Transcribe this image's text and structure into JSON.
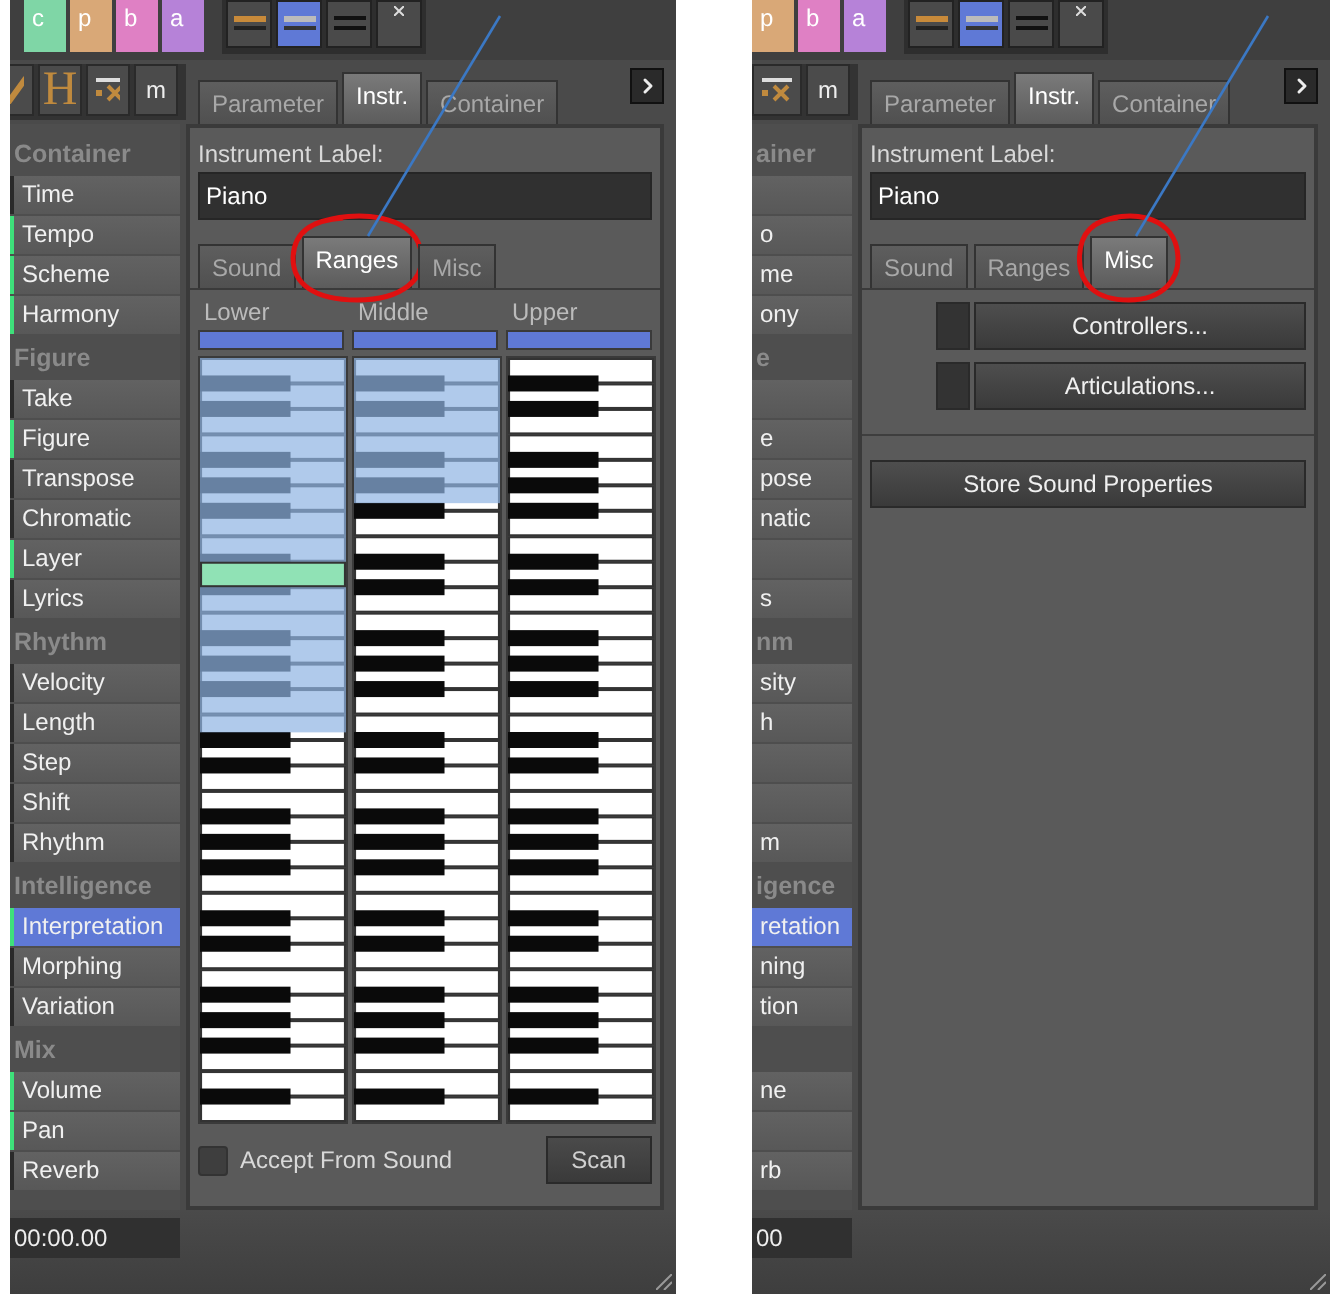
{
  "panels": [
    {
      "swatches": [
        {
          "label": "c",
          "color": "#7fd6a6"
        },
        {
          "label": "p",
          "color": "#d9a877"
        },
        {
          "label": "b",
          "color": "#df80c4"
        },
        {
          "label": "a",
          "color": "#b682d8"
        }
      ],
      "tool_buttons": [
        {
          "kind": "orange-bar",
          "selected": false
        },
        {
          "kind": "grey-bar",
          "selected": true
        },
        {
          "kind": "lines",
          "selected": false
        },
        {
          "kind": "close",
          "selected": false
        }
      ],
      "mode_buttons": [
        {
          "kind": "check"
        },
        {
          "kind": "serif-letter",
          "label": "H"
        },
        {
          "kind": "formula"
        },
        {
          "kind": "letter",
          "label": "m"
        }
      ],
      "tabs": [
        {
          "label": "Parameter",
          "selected": false
        },
        {
          "label": "Instr.",
          "selected": true
        },
        {
          "label": "Container",
          "selected": false
        }
      ],
      "sidebar": [
        {
          "kind": "header",
          "label": "Container"
        },
        {
          "kind": "item",
          "label": "Time",
          "active": false,
          "selected": false
        },
        {
          "kind": "item",
          "label": "Tempo",
          "active": true,
          "selected": false
        },
        {
          "kind": "item",
          "label": "Scheme",
          "active": true,
          "selected": false
        },
        {
          "kind": "item",
          "label": "Harmony",
          "active": true,
          "selected": false
        },
        {
          "kind": "header",
          "label": "Figure"
        },
        {
          "kind": "item",
          "label": "Take",
          "active": false,
          "selected": false
        },
        {
          "kind": "item",
          "label": "Figure",
          "active": true,
          "selected": false
        },
        {
          "kind": "item",
          "label": "Transpose",
          "active": false,
          "selected": false
        },
        {
          "kind": "item",
          "label": "Chromatic",
          "active": false,
          "selected": false
        },
        {
          "kind": "item",
          "label": "Layer",
          "active": true,
          "selected": false
        },
        {
          "kind": "item",
          "label": "Lyrics",
          "active": false,
          "selected": false
        },
        {
          "kind": "header",
          "label": "Rhythm"
        },
        {
          "kind": "item",
          "label": "Velocity",
          "active": false,
          "selected": false
        },
        {
          "kind": "item",
          "label": "Length",
          "active": false,
          "selected": false
        },
        {
          "kind": "item",
          "label": "Step",
          "active": false,
          "selected": false
        },
        {
          "kind": "item",
          "label": "Shift",
          "active": false,
          "selected": false
        },
        {
          "kind": "item",
          "label": "Rhythm",
          "active": false,
          "selected": false
        },
        {
          "kind": "header",
          "label": "Intelligence"
        },
        {
          "kind": "item",
          "label": "Interpretation",
          "active": true,
          "selected": true
        },
        {
          "kind": "item",
          "label": "Morphing",
          "active": false,
          "selected": false
        },
        {
          "kind": "item",
          "label": "Variation",
          "active": false,
          "selected": false
        },
        {
          "kind": "header",
          "label": "Mix"
        },
        {
          "kind": "item",
          "label": "Volume",
          "active": true,
          "selected": false
        },
        {
          "kind": "item",
          "label": "Pan",
          "active": true,
          "selected": false
        },
        {
          "kind": "item",
          "label": "Reverb",
          "active": false,
          "selected": false
        }
      ],
      "instrument_label": {
        "label": "Instrument Label:",
        "value": "Piano"
      },
      "subtabs": [
        {
          "label": "Sound",
          "selected": false,
          "circled": false
        },
        {
          "label": "Ranges",
          "selected": true,
          "circled": true
        },
        {
          "label": "Misc",
          "selected": false,
          "circled": false
        }
      ],
      "content": {
        "kind": "ranges",
        "keyboards": [
          {
            "label": "Lower",
            "level": 0.49,
            "marker": true
          },
          {
            "label": "Middle",
            "level": 0.19,
            "marker": false
          },
          {
            "label": "Upper",
            "marker": false
          }
        ],
        "checkbox": {
          "label": "Accept From Sound",
          "checked": false
        },
        "scan_button": "Scan"
      },
      "time": "00:00.00"
    },
    {
      "swatches": [
        {
          "label": "p",
          "color": "#d9a877"
        },
        {
          "label": "b",
          "color": "#df80c4"
        },
        {
          "label": "a",
          "color": "#b682d8"
        }
      ],
      "tool_buttons": [
        {
          "kind": "orange-bar",
          "selected": false
        },
        {
          "kind": "grey-bar",
          "selected": true
        },
        {
          "kind": "lines",
          "selected": false
        },
        {
          "kind": "close",
          "selected": false
        }
      ],
      "mode_buttons": [
        {
          "kind": "formula"
        },
        {
          "kind": "letter",
          "label": "m"
        }
      ],
      "tabs": [
        {
          "label": "Parameter",
          "selected": false
        },
        {
          "label": "Instr.",
          "selected": true
        },
        {
          "label": "Container",
          "selected": false
        }
      ],
      "sidebar": [
        {
          "kind": "header",
          "label": "ainer"
        },
        {
          "kind": "item",
          "selected": false
        },
        {
          "kind": "item",
          "label": "o",
          "selected": false
        },
        {
          "kind": "item",
          "label": "me",
          "selected": false
        },
        {
          "kind": "item",
          "label": "ony",
          "selected": false
        },
        {
          "kind": "header",
          "label": "e"
        },
        {
          "kind": "item",
          "selected": false
        },
        {
          "kind": "item",
          "label": "e",
          "selected": false
        },
        {
          "kind": "item",
          "label": "pose",
          "selected": false
        },
        {
          "kind": "item",
          "label": "natic",
          "selected": false
        },
        {
          "kind": "item",
          "selected": false
        },
        {
          "kind": "item",
          "label": "s",
          "selected": false
        },
        {
          "kind": "header",
          "label": "nm"
        },
        {
          "kind": "item",
          "label": "sity",
          "selected": false
        },
        {
          "kind": "item",
          "label": "h",
          "selected": false
        },
        {
          "kind": "item",
          "selected": false
        },
        {
          "kind": "item",
          "selected": false
        },
        {
          "kind": "item",
          "label": "m",
          "selected": false
        },
        {
          "kind": "header",
          "label": "igence"
        },
        {
          "kind": "item",
          "label": "retation",
          "selected": true
        },
        {
          "kind": "item",
          "label": "ning",
          "selected": false
        },
        {
          "kind": "item",
          "label": "tion",
          "selected": false
        },
        {
          "kind": "header"
        },
        {
          "kind": "item",
          "label": "ne",
          "selected": false
        },
        {
          "kind": "item",
          "selected": false
        },
        {
          "kind": "item",
          "label": "rb",
          "selected": false
        }
      ],
      "instrument_label": {
        "label": "Instrument Label:",
        "value": "Piano"
      },
      "subtabs": [
        {
          "label": "Sound",
          "selected": false,
          "circled": false
        },
        {
          "label": "Ranges",
          "selected": false,
          "circled": false
        },
        {
          "label": "Misc",
          "selected": true,
          "circled": true
        }
      ],
      "content": {
        "kind": "misc",
        "buttons": [
          "Controllers...",
          "Articulations..."
        ],
        "store_button": "Store Sound Properties"
      },
      "time": "00"
    }
  ]
}
